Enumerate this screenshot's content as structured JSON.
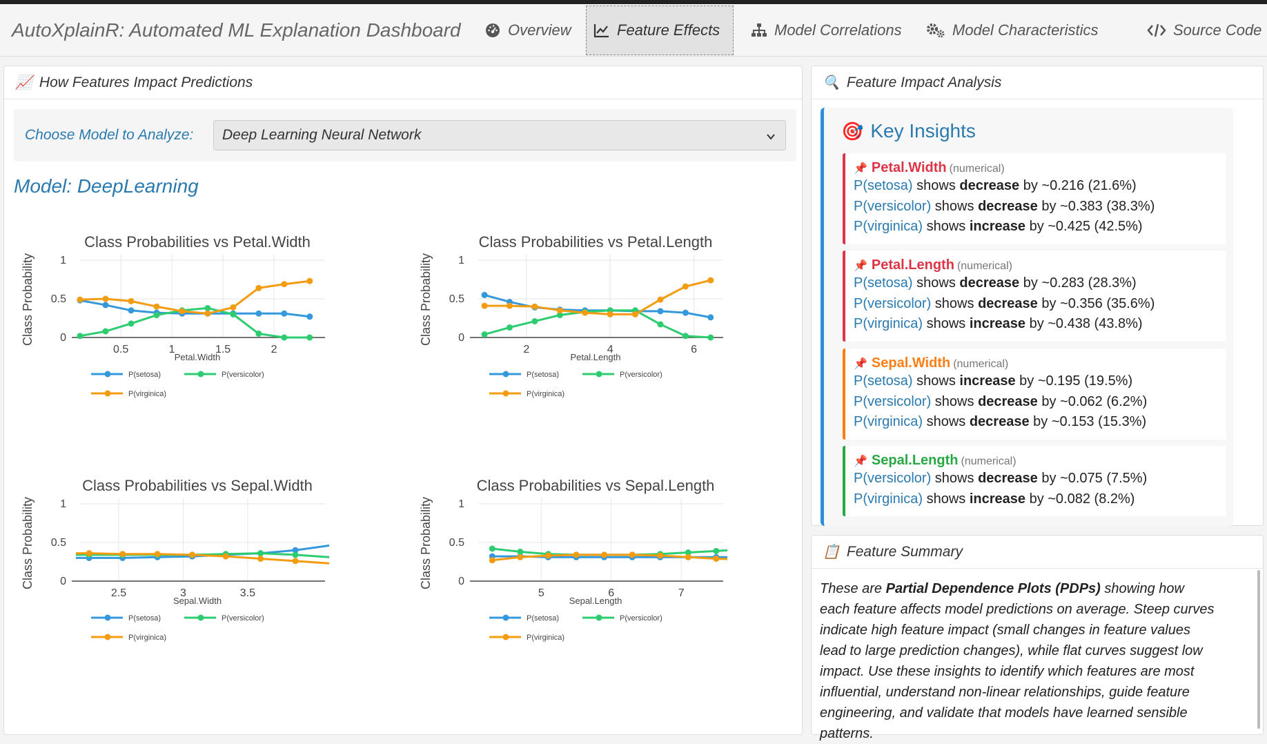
{
  "app": {
    "title": "AutoXplainR: Automated ML Explanation Dashboard"
  },
  "nav": {
    "overview": "Overview",
    "feature_effects": "Feature Effects",
    "model_correlations": "Model Correlations",
    "model_characteristics": "Model Characteristics",
    "source_code": "Source Code"
  },
  "left_panel": {
    "title": "How Features Impact Predictions",
    "emoji": "📈",
    "selector_label": "Choose Model to Analyze:",
    "selected_model": "Deep Learning Neural Network",
    "model_title": "Model: DeepLearning"
  },
  "colors": {
    "setosa": "#3498db",
    "versicolor": "#2ecc71",
    "virginica": "#f39c12",
    "petal_width": "#dc3545",
    "petal_length": "#dc3545",
    "sepal_width": "#fd7e14",
    "sepal_length": "#28a745"
  },
  "chart_data": [
    {
      "type": "line",
      "title": "Class Probabilities vs Petal.Width",
      "xlabel": "Petal.Width",
      "ylabel": "Class Probability",
      "xlim": [
        0.1,
        2.5
      ],
      "ylim": [
        0,
        1
      ],
      "xticks": [
        0.5,
        1,
        1.5,
        2
      ],
      "xtick_labels": [
        "0.5",
        "1",
        "1.5",
        "2"
      ],
      "yticks": [
        0,
        0.5,
        1
      ],
      "ytick_labels": [
        "0",
        "0.5",
        "1"
      ],
      "x": [
        0.1,
        0.35,
        0.6,
        0.85,
        1.1,
        1.35,
        1.6,
        1.85,
        2.1,
        2.35
      ],
      "series": [
        {
          "name": "P(setosa)",
          "values": [
            0.48,
            0.42,
            0.35,
            0.32,
            0.31,
            0.31,
            0.31,
            0.31,
            0.31,
            0.27
          ]
        },
        {
          "name": "P(versicolor)",
          "values": [
            0.02,
            0.08,
            0.18,
            0.29,
            0.35,
            0.38,
            0.3,
            0.05,
            0.0,
            0.0
          ]
        },
        {
          "name": "P(virginica)",
          "values": [
            0.49,
            0.5,
            0.47,
            0.4,
            0.34,
            0.31,
            0.39,
            0.64,
            0.69,
            0.73
          ]
        }
      ],
      "legend": "bottom"
    },
    {
      "type": "line",
      "title": "Class Probabilities vs Petal.Length",
      "xlabel": "Petal.Length",
      "ylabel": "Class Probability",
      "xlim": [
        0.85,
        6.7
      ],
      "ylim": [
        0,
        1
      ],
      "xticks": [
        2,
        4,
        6
      ],
      "xtick_labels": [
        "2",
        "4",
        "6"
      ],
      "yticks": [
        0,
        0.5,
        1
      ],
      "ytick_labels": [
        "0",
        "0.5",
        "1"
      ],
      "x": [
        1.0,
        1.6,
        2.2,
        2.8,
        3.4,
        4.0,
        4.6,
        5.2,
        5.8,
        6.4
      ],
      "series": [
        {
          "name": "P(setosa)",
          "values": [
            0.55,
            0.46,
            0.39,
            0.36,
            0.35,
            0.35,
            0.34,
            0.34,
            0.32,
            0.26
          ]
        },
        {
          "name": "P(versicolor)",
          "values": [
            0.04,
            0.13,
            0.21,
            0.29,
            0.33,
            0.35,
            0.35,
            0.17,
            0.02,
            0.0
          ]
        },
        {
          "name": "P(virginica)",
          "values": [
            0.41,
            0.41,
            0.4,
            0.35,
            0.32,
            0.3,
            0.3,
            0.49,
            0.66,
            0.74
          ]
        }
      ],
      "legend": "bottom"
    },
    {
      "type": "line",
      "title": "Class Probabilities vs Sepal.Width",
      "xlabel": "Sepal.Width",
      "ylabel": "Class Probability",
      "xlim": [
        2.2,
        4.1
      ],
      "ylim": [
        0,
        1
      ],
      "xticks": [
        2.5,
        3,
        3.5
      ],
      "xtick_labels": [
        "2.5",
        "3",
        "3.5"
      ],
      "yticks": [
        0,
        0.5,
        1
      ],
      "ytick_labels": [
        "0",
        "0.5",
        "1"
      ],
      "x": [
        2.0,
        2.27,
        2.53,
        2.8,
        3.07,
        3.33,
        3.6,
        3.87,
        4.13,
        4.4
      ],
      "series": [
        {
          "name": "P(setosa)",
          "values": [
            0.3,
            0.3,
            0.3,
            0.31,
            0.32,
            0.34,
            0.36,
            0.4,
            0.46,
            0.49
          ]
        },
        {
          "name": "P(versicolor)",
          "values": [
            0.34,
            0.34,
            0.34,
            0.34,
            0.34,
            0.35,
            0.36,
            0.34,
            0.31,
            0.3
          ]
        },
        {
          "name": "P(virginica)",
          "values": [
            0.36,
            0.36,
            0.35,
            0.35,
            0.34,
            0.32,
            0.29,
            0.26,
            0.23,
            0.2
          ]
        }
      ],
      "legend": "bottom"
    },
    {
      "type": "line",
      "title": "Class Probabilities vs Sepal.Length",
      "xlabel": "Sepal.Length",
      "ylabel": "Class Probability",
      "xlim": [
        4.1,
        7.6
      ],
      "ylim": [
        0,
        1
      ],
      "xticks": [
        5,
        6,
        7
      ],
      "xtick_labels": [
        "5",
        "6",
        "7"
      ],
      "yticks": [
        0,
        0.5,
        1
      ],
      "ytick_labels": [
        "0",
        "0.5",
        "1"
      ],
      "x": [
        4.3,
        4.7,
        5.1,
        5.5,
        5.9,
        6.3,
        6.7,
        7.1,
        7.5,
        7.9
      ],
      "series": [
        {
          "name": "P(setosa)",
          "values": [
            0.32,
            0.32,
            0.31,
            0.31,
            0.31,
            0.31,
            0.31,
            0.31,
            0.31,
            0.31
          ]
        },
        {
          "name": "P(versicolor)",
          "values": [
            0.42,
            0.38,
            0.35,
            0.34,
            0.34,
            0.34,
            0.35,
            0.37,
            0.39,
            0.41
          ]
        },
        {
          "name": "P(virginica)",
          "values": [
            0.27,
            0.31,
            0.33,
            0.34,
            0.34,
            0.34,
            0.33,
            0.31,
            0.29,
            0.28
          ]
        }
      ],
      "legend": "bottom"
    }
  ],
  "right_panel": {
    "title": "Feature Impact Analysis",
    "emoji": "🔍",
    "insights_title": "Key Insights",
    "insights_emoji": "🎯",
    "pin": "📌",
    "features": [
      {
        "name": "Petal.Width",
        "type": "(numerical)",
        "lines": [
          {
            "cls": "P(setosa)",
            "mid": " shows ",
            "dir": "decrease",
            "tail": " by ~0.216 (21.6%)"
          },
          {
            "cls": "P(versicolor)",
            "mid": " shows ",
            "dir": "decrease",
            "tail": " by ~0.383 (38.3%)"
          },
          {
            "cls": "P(virginica)",
            "mid": " shows ",
            "dir": "increase",
            "tail": " by ~0.425 (42.5%)"
          }
        ]
      },
      {
        "name": "Petal.Length",
        "type": "(numerical)",
        "lines": [
          {
            "cls": "P(setosa)",
            "mid": " shows ",
            "dir": "decrease",
            "tail": " by ~0.283 (28.3%)"
          },
          {
            "cls": "P(versicolor)",
            "mid": " shows ",
            "dir": "decrease",
            "tail": " by ~0.356 (35.6%)"
          },
          {
            "cls": "P(virginica)",
            "mid": " shows ",
            "dir": "increase",
            "tail": " by ~0.438 (43.8%)"
          }
        ]
      },
      {
        "name": "Sepal.Width",
        "type": "(numerical)",
        "lines": [
          {
            "cls": "P(setosa)",
            "mid": " shows ",
            "dir": "increase",
            "tail": " by ~0.195 (19.5%)"
          },
          {
            "cls": "P(versicolor)",
            "mid": " shows ",
            "dir": "decrease",
            "tail": " by ~0.062 (6.2%)"
          },
          {
            "cls": "P(virginica)",
            "mid": " shows ",
            "dir": "decrease",
            "tail": " by ~0.153 (15.3%)"
          }
        ]
      },
      {
        "name": "Sepal.Length",
        "type": "(numerical)",
        "lines": [
          {
            "cls": "P(versicolor)",
            "mid": " shows ",
            "dir": "decrease",
            "tail": " by ~0.075 (7.5%)"
          },
          {
            "cls": "P(virginica)",
            "mid": " shows ",
            "dir": "increase",
            "tail": " by ~0.082 (8.2%)"
          }
        ]
      }
    ]
  },
  "summary_panel": {
    "title": "Feature Summary",
    "emoji": "📋",
    "intro": "These are ",
    "bold": "Partial Dependence Plots (PDPs)",
    "rest": " showing how each feature affects model predictions on average. Steep curves indicate high feature impact (small changes in feature values lead to large prediction changes), while flat curves suggest low impact. Use these insights to identify which features are most influential, understand non-linear relationships, guide feature engineering, and validate that models have learned sensible patterns."
  }
}
